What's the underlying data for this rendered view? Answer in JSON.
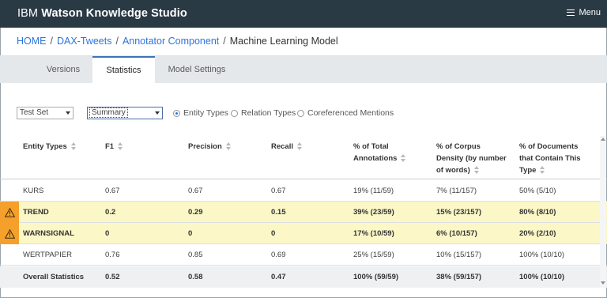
{
  "header": {
    "brand_prefix": "IBM",
    "brand_name": "Watson Knowledge Studio",
    "menu_label": "Menu"
  },
  "breadcrumb": {
    "items": [
      "HOME",
      "DAX-Tweets",
      "Annotator Component"
    ],
    "current": "Machine Learning Model",
    "separator": "/"
  },
  "tabs": [
    {
      "label": "Versions"
    },
    {
      "label": "Statistics",
      "active": true
    },
    {
      "label": "Model Settings"
    }
  ],
  "filters": {
    "set_select": "Test Set",
    "view_select": "Summary",
    "radios": [
      {
        "label": "Entity Types",
        "selected": true
      },
      {
        "label": "Relation Types",
        "selected": false
      },
      {
        "label": "Coreferenced Mentions",
        "selected": false
      }
    ]
  },
  "table": {
    "columns": [
      [
        "Entity Types"
      ],
      [
        "F1"
      ],
      [
        "Precision"
      ],
      [
        "Recall"
      ],
      [
        "% of Total",
        "Annotations"
      ],
      [
        "% of Corpus",
        "Density (by number",
        "of words)"
      ],
      [
        "% of Documents",
        "that Contain This",
        "Type"
      ]
    ],
    "rows": [
      {
        "cells": [
          "KURS",
          "0.67",
          "0.67",
          "0.67",
          "19% (11/59)",
          "7% (11/157)",
          "50% (5/10)"
        ],
        "warning": false
      },
      {
        "cells": [
          "TREND",
          "0.2",
          "0.29",
          "0.15",
          "39% (23/59)",
          "15% (23/157)",
          "80% (8/10)"
        ],
        "warning": true
      },
      {
        "cells": [
          "WARNSIGNAL",
          "0",
          "0",
          "0",
          "17% (10/59)",
          "6% (10/157)",
          "20% (2/10)"
        ],
        "warning": true
      },
      {
        "cells": [
          "WERTPAPIER",
          "0.76",
          "0.85",
          "0.69",
          "25% (15/59)",
          "10% (15/157)",
          "100% (10/10)"
        ],
        "warning": false
      }
    ],
    "total": [
      "Overall Statistics",
      "0.52",
      "0.58",
      "0.47",
      "100% (59/59)",
      "38% (59/157)",
      "100% (10/10)"
    ]
  },
  "colors": {
    "topbar": "#2a3a45",
    "link": "#2d74da",
    "warning_row": "#fbf7c7",
    "warning_icon_bg": "#f4a02a"
  },
  "icons": {
    "menu": "hamburger-icon",
    "warning": "warning-triangle-icon",
    "sort": "sort-arrows-icon",
    "dropdown": "caret-down-icon"
  }
}
